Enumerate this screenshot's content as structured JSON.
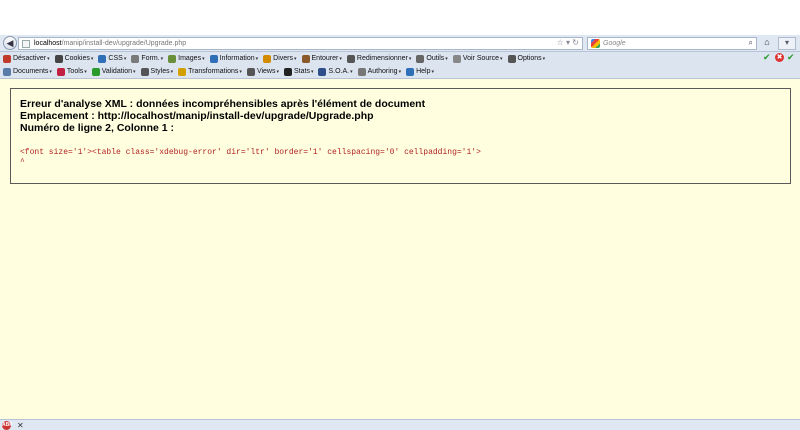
{
  "navbar": {
    "back_icon": "back-arrow-icon",
    "url_host": "localhost",
    "url_path": "/manip/install-dev/upgrade/Upgrade.php",
    "search_placeholder": "Google",
    "home_icon": "home-icon"
  },
  "toolbar1": {
    "items": [
      {
        "label": "Désactiver",
        "icon": "no-icon",
        "color": "#c0392b"
      },
      {
        "label": "Cookies",
        "icon": "user-icon",
        "color": "#444444"
      },
      {
        "label": "CSS",
        "icon": "pencil-icon",
        "color": "#2e6fb8"
      },
      {
        "label": "Form.",
        "icon": "form-icon",
        "color": "#7a7a7a"
      },
      {
        "label": "Images",
        "icon": "image-icon",
        "color": "#6a8f3a"
      },
      {
        "label": "Information",
        "icon": "info-icon",
        "color": "#2e6fb8"
      },
      {
        "label": "Divers",
        "icon": "misc-icon",
        "color": "#d28b00"
      },
      {
        "label": "Entourer",
        "icon": "outline-icon",
        "color": "#8a5a2a"
      },
      {
        "label": "Redimensionner",
        "icon": "resize-icon",
        "color": "#555555"
      },
      {
        "label": "Outils",
        "icon": "tools-icon",
        "color": "#666666"
      },
      {
        "label": "Voir Source",
        "icon": "source-icon",
        "color": "#888888"
      },
      {
        "label": "Options",
        "icon": "options-icon",
        "color": "#555555"
      }
    ]
  },
  "toolbar2": {
    "items": [
      {
        "label": "Documents",
        "icon": "document-icon",
        "color": "#5a7aa8"
      },
      {
        "label": "Tools",
        "icon": "tools-icon",
        "color": "#c02040"
      },
      {
        "label": "Validation",
        "icon": "check-icon",
        "color": "#2a9a2a"
      },
      {
        "label": "Styles",
        "icon": "styles-icon",
        "color": "#555555"
      },
      {
        "label": "Transformations",
        "icon": "transform-icon",
        "color": "#d2a000"
      },
      {
        "label": "Views",
        "icon": "views-icon",
        "color": "#555555"
      },
      {
        "label": "Stats",
        "icon": "sigma-icon",
        "color": "#222222"
      },
      {
        "label": "S.O.A.",
        "icon": "soa-icon",
        "color": "#2e4f8a"
      },
      {
        "label": "Authoring",
        "icon": "authoring-icon",
        "color": "#777777"
      },
      {
        "label": "Help",
        "icon": "help-icon",
        "color": "#2e6fb8"
      }
    ]
  },
  "error": {
    "line1": "Erreur d'analyse XML : données incompréhensibles après l'élément de document",
    "line2": "Emplacement : http://localhost/manip/install-dev/upgrade/Upgrade.php",
    "line3": "Numéro de ligne 2, Colonne 1 :",
    "source_line": "<font size='1'><table class='xdebug-error' dir='ltr' border='1' cellspacing='0' cellpadding='1'>",
    "caret": "^"
  },
  "statusbar": {
    "abp_label": "ABP"
  }
}
